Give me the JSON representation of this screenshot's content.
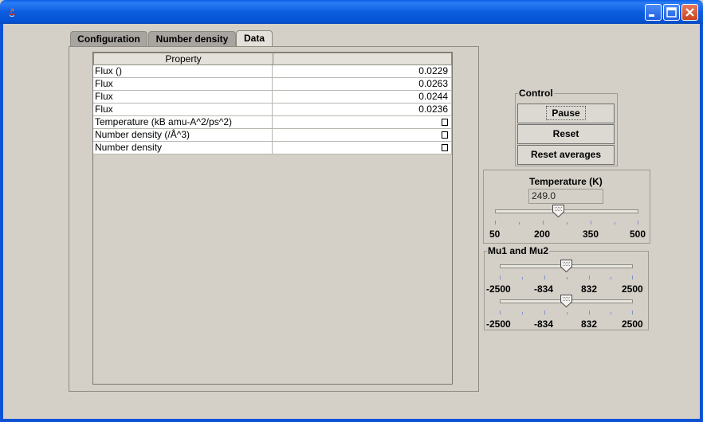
{
  "window": {
    "title": ""
  },
  "tabs": [
    {
      "label": "Configuration",
      "active": false
    },
    {
      "label": "Number density",
      "active": false
    },
    {
      "label": "Data",
      "active": true
    }
  ],
  "table": {
    "headers": [
      "Property",
      ""
    ],
    "rows": [
      {
        "property": "Flux ()",
        "value": "0.0229"
      },
      {
        "property": "Flux",
        "value": "0.0263"
      },
      {
        "property": "Flux",
        "value": "0.0244"
      },
      {
        "property": "Flux",
        "value": "0.0236"
      },
      {
        "property": "Temperature (kB amu-A^2/ps^2)",
        "value": ""
      },
      {
        "property": "Number density (/Å^3)",
        "value": ""
      },
      {
        "property": "Number density",
        "value": ""
      }
    ]
  },
  "control": {
    "title": "Control",
    "pause_label": "Pause",
    "reset_label": "Reset",
    "reset_averages_label": "Reset averages"
  },
  "temperature": {
    "title": "Temperature (K)",
    "value": "249.0",
    "slider_fraction": 0.4425,
    "tick_labels": [
      "50",
      "200",
      "350",
      "500"
    ]
  },
  "mu": {
    "title": "Mu1 and Mu2",
    "slider1_fraction": 0.5,
    "slider2_fraction": 0.5,
    "tick_labels": [
      "-2500",
      "-834",
      "832",
      "2500"
    ]
  },
  "colors": {
    "titlebar": "#0b5ddf",
    "background": "#d4d0c8",
    "tick": "#8090c8"
  }
}
